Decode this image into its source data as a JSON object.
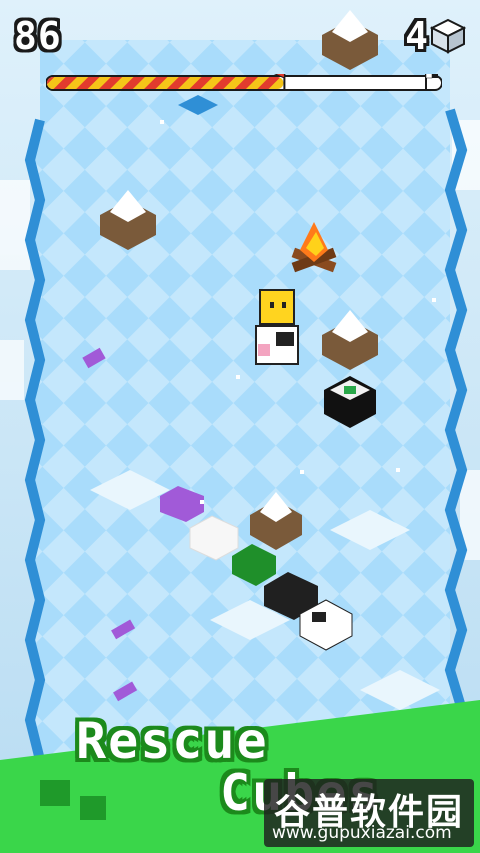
{
  "hud": {
    "score": "86",
    "cubes_collected": "4",
    "level_progress": 0.6
  },
  "promo": {
    "line1": "Rescue",
    "line2": "Cubes"
  },
  "watermark": {
    "brand": "谷普软件园",
    "url": "www.gupuxiazai.com"
  },
  "colors": {
    "ice_top": "#bfe4fb",
    "ice_side": "#2f8fd6",
    "progress_fill": "#f5c518",
    "progress_stripe": "#e23b2e",
    "green_banner": "#3ad64a"
  },
  "icons": [
    "cube-icon",
    "flag-icon",
    "checkered-flag-icon",
    "campfire-icon",
    "snow-rock-icon"
  ]
}
